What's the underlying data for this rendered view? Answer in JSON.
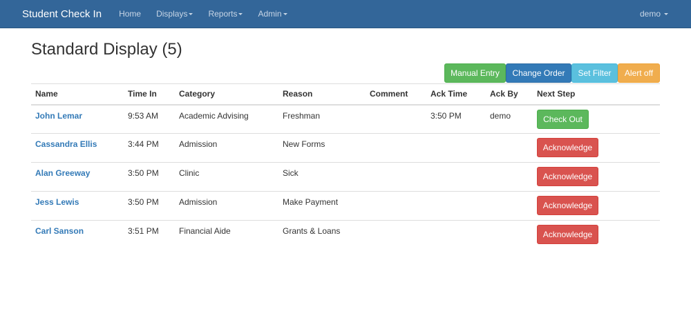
{
  "navbar": {
    "brand": "Student Check In",
    "items": [
      {
        "label": "Home",
        "dropdown": false
      },
      {
        "label": "Displays",
        "dropdown": true
      },
      {
        "label": "Reports",
        "dropdown": true
      },
      {
        "label": "Admin",
        "dropdown": true
      }
    ],
    "user": "demo"
  },
  "page": {
    "title": "Standard Display (5)"
  },
  "actions": {
    "manual_entry": "Manual Entry",
    "change_order": "Change Order",
    "set_filter": "Set Filter",
    "alert_off": "Alert off"
  },
  "table": {
    "headers": [
      "Name",
      "Time In",
      "Category",
      "Reason",
      "Comment",
      "Ack Time",
      "Ack By",
      "Next Step"
    ],
    "rows": [
      {
        "name": "John Lemar",
        "time_in": "9:53 AM",
        "category": "Academic Advising",
        "reason": "Freshman",
        "comment": "",
        "ack_time": "3:50 PM",
        "ack_by": "demo",
        "next_step": "Check Out",
        "next_step_style": "success"
      },
      {
        "name": "Cassandra Ellis",
        "time_in": "3:44 PM",
        "category": "Admission",
        "reason": "New Forms",
        "comment": "",
        "ack_time": "",
        "ack_by": "",
        "next_step": "Acknowledge",
        "next_step_style": "danger"
      },
      {
        "name": "Alan Greeway",
        "time_in": "3:50 PM",
        "category": "Clinic",
        "reason": "Sick",
        "comment": "",
        "ack_time": "",
        "ack_by": "",
        "next_step": "Acknowledge",
        "next_step_style": "danger"
      },
      {
        "name": "Jess Lewis",
        "time_in": "3:50 PM",
        "category": "Admission",
        "reason": "Make Payment",
        "comment": "",
        "ack_time": "",
        "ack_by": "",
        "next_step": "Acknowledge",
        "next_step_style": "danger"
      },
      {
        "name": "Carl Sanson",
        "time_in": "3:51 PM",
        "category": "Financial Aide",
        "reason": "Grants & Loans",
        "comment": "",
        "ack_time": "",
        "ack_by": "",
        "next_step": "Acknowledge",
        "next_step_style": "danger"
      }
    ]
  },
  "colors": {
    "navbar": "#336699",
    "link": "#337ab7",
    "success": "#5cb85c",
    "primary": "#337ab7",
    "info": "#5bc0de",
    "warning": "#f0ad4e",
    "danger": "#d9534f"
  }
}
